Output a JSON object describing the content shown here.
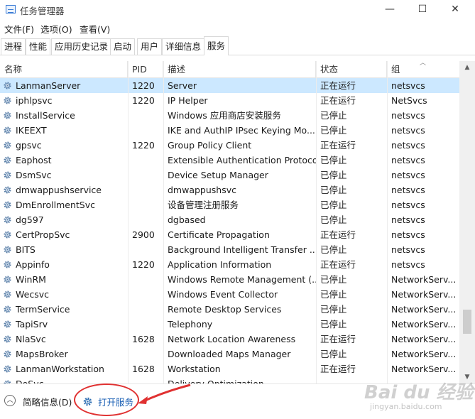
{
  "window": {
    "title": "任务管理器",
    "min": "—",
    "max": "☐",
    "close": "✕"
  },
  "menu": [
    "文件(F)",
    "选项(O)",
    "查看(V)"
  ],
  "tabs": [
    "进程",
    "性能",
    "应用历史记录",
    "启动",
    "用户",
    "详细信息",
    "服务"
  ],
  "active_tab": "服务",
  "columns": {
    "name": "名称",
    "pid": "PID",
    "desc": "描述",
    "status": "状态",
    "group": "组"
  },
  "rows": [
    {
      "name": "LanmanServer",
      "pid": "1220",
      "desc": "Server",
      "status": "正在运行",
      "group": "netsvcs",
      "selected": true
    },
    {
      "name": "iphlpsvc",
      "pid": "1220",
      "desc": "IP Helper",
      "status": "正在运行",
      "group": "NetSvcs"
    },
    {
      "name": "InstallService",
      "pid": "",
      "desc": "Windows 应用商店安装服务",
      "status": "已停止",
      "group": "netsvcs"
    },
    {
      "name": "IKEEXT",
      "pid": "",
      "desc": "IKE and AuthIP IPsec Keying Mo...",
      "status": "已停止",
      "group": "netsvcs"
    },
    {
      "name": "gpsvc",
      "pid": "1220",
      "desc": "Group Policy Client",
      "status": "正在运行",
      "group": "netsvcs"
    },
    {
      "name": "Eaphost",
      "pid": "",
      "desc": "Extensible Authentication Protocol",
      "status": "已停止",
      "group": "netsvcs"
    },
    {
      "name": "DsmSvc",
      "pid": "",
      "desc": "Device Setup Manager",
      "status": "已停止",
      "group": "netsvcs"
    },
    {
      "name": "dmwappushservice",
      "pid": "",
      "desc": "dmwappushsvc",
      "status": "已停止",
      "group": "netsvcs"
    },
    {
      "name": "DmEnrollmentSvc",
      "pid": "",
      "desc": "设备管理注册服务",
      "status": "已停止",
      "group": "netsvcs"
    },
    {
      "name": "dg597",
      "pid": "",
      "desc": "dgbased",
      "status": "已停止",
      "group": "netsvcs"
    },
    {
      "name": "CertPropSvc",
      "pid": "2900",
      "desc": "Certificate Propagation",
      "status": "正在运行",
      "group": "netsvcs"
    },
    {
      "name": "BITS",
      "pid": "",
      "desc": "Background Intelligent Transfer ...",
      "status": "已停止",
      "group": "netsvcs"
    },
    {
      "name": "Appinfo",
      "pid": "1220",
      "desc": "Application Information",
      "status": "正在运行",
      "group": "netsvcs"
    },
    {
      "name": "WinRM",
      "pid": "",
      "desc": "Windows Remote Management (...",
      "status": "已停止",
      "group": "NetworkServ..."
    },
    {
      "name": "Wecsvc",
      "pid": "",
      "desc": "Windows Event Collector",
      "status": "已停止",
      "group": "NetworkServ..."
    },
    {
      "name": "TermService",
      "pid": "",
      "desc": "Remote Desktop Services",
      "status": "已停止",
      "group": "NetworkServ..."
    },
    {
      "name": "TapiSrv",
      "pid": "",
      "desc": "Telephony",
      "status": "已停止",
      "group": "NetworkServ..."
    },
    {
      "name": "NlaSvc",
      "pid": "1628",
      "desc": "Network Location Awareness",
      "status": "正在运行",
      "group": "NetworkServ..."
    },
    {
      "name": "MapsBroker",
      "pid": "",
      "desc": "Downloaded Maps Manager",
      "status": "已停止",
      "group": "NetworkServ..."
    },
    {
      "name": "LanmanWorkstation",
      "pid": "1628",
      "desc": "Workstation",
      "status": "正在运行",
      "group": "NetworkServ..."
    },
    {
      "name": "DoSvc",
      "pid": "",
      "desc": "Delivery Optimization",
      "status": "",
      "group": ""
    }
  ],
  "footer": {
    "brief": "简略信息(D)",
    "open_services": "打开服务"
  },
  "watermark": {
    "main": "Bai du 经验",
    "sub": "jingyan.baidu.com"
  },
  "colors": {
    "selected_row": "#cce8ff",
    "link": "#1a5fb4",
    "annotation": "#e03131"
  }
}
